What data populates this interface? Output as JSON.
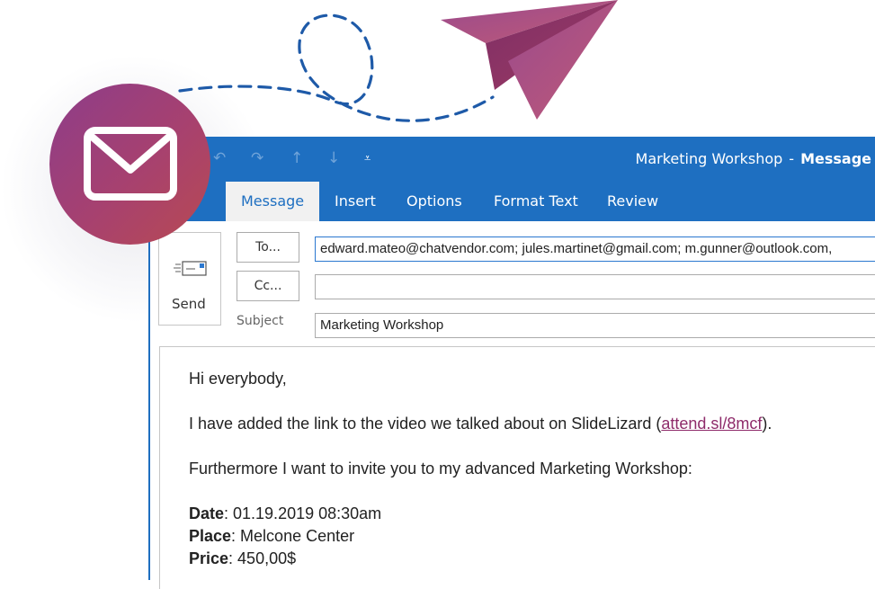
{
  "window": {
    "title": "Marketing Workshop",
    "title_separator": "-",
    "title_mode": "Message",
    "quick_access": [
      "undo-icon",
      "redo-icon",
      "up-arrow-icon",
      "down-arrow-icon",
      "customize-icon"
    ]
  },
  "ribbon": {
    "tabs": [
      {
        "label": "Message",
        "active": true
      },
      {
        "label": "Insert",
        "active": false
      },
      {
        "label": "Options",
        "active": false
      },
      {
        "label": "Format Text",
        "active": false
      },
      {
        "label": "Review",
        "active": false
      }
    ]
  },
  "compose": {
    "send_label": "Send",
    "to_label": "To...",
    "cc_label": "Cc...",
    "subject_label": "Subject",
    "to_value": "edward.mateo@chatvendor.com; jules.martinet@gmail.com; m.gunner@outlook.com,",
    "cc_value": "",
    "subject_value": "Marketing Workshop"
  },
  "body": {
    "greeting": "Hi everybody,",
    "line1_before": "I have added the link to the video we talked about on SlideLizard (",
    "line1_link": "attend.sl/8mcf",
    "line1_after": ").",
    "line2": "Furthermore I want to invite you to my advanced Marketing Workshop:",
    "date_label": "Date",
    "date_value": ":  01.19.2019  08:30am",
    "place_label": "Place",
    "place_value": ": Melcone Center",
    "price_label": "Price",
    "price_value": ":  450,00$"
  },
  "colors": {
    "ribbon_blue": "#1e6fc1",
    "link": "#8e2b6a",
    "accent_gradient_start": "#8d3d8a",
    "accent_gradient_end": "#b84a52",
    "dash_line": "#1e5aa8"
  }
}
